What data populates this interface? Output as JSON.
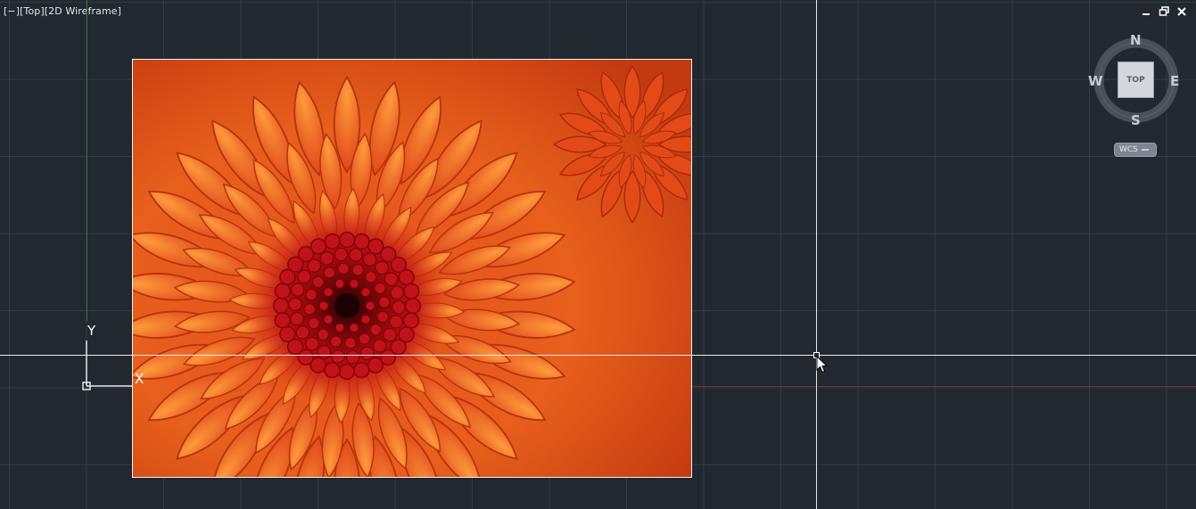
{
  "viewport": {
    "label": "[−][Top][2D Wireframe]",
    "window_controls": [
      "minimize-icon",
      "restore-icon",
      "close-icon"
    ]
  },
  "ucs": {
    "x_label": "X",
    "y_label": "Y"
  },
  "viewcube": {
    "north": "N",
    "south": "S",
    "east": "E",
    "west": "W",
    "face": "TOP",
    "coord_system": "WCS"
  },
  "image": {
    "subject": "orange chrysanthemum photo raster"
  },
  "colors": {
    "background": "#212830",
    "grid": "#3e4854",
    "crosshair": "#e8e8e8",
    "y_axis": "#2f7a2f",
    "x_axis": "#7a2a2a"
  }
}
